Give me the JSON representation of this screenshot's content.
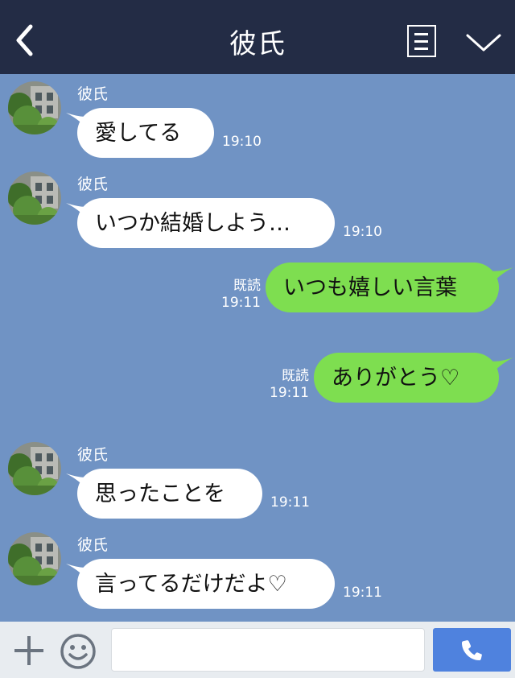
{
  "header": {
    "title": "彼氏",
    "back_icon": "chevron-left-icon",
    "menu_icon": "menu-icon",
    "collapse_icon": "chevron-down-icon"
  },
  "messages": [
    {
      "side": "in",
      "sender": "彼氏",
      "text": "愛してる",
      "time": "19:10"
    },
    {
      "side": "in",
      "sender": "彼氏",
      "text": "いつか結婚しよう…",
      "time": "19:10"
    },
    {
      "side": "out",
      "read": "既読",
      "text": "いつも嬉しい言葉",
      "time": "19:11"
    },
    {
      "side": "out",
      "read": "既読",
      "text": "ありがとう♡",
      "time": "19:11"
    },
    {
      "side": "in",
      "sender": "彼氏",
      "text": "思ったことを",
      "time": "19:11"
    },
    {
      "side": "in",
      "sender": "彼氏",
      "text": "言ってるだけだよ♡",
      "time": "19:11"
    }
  ],
  "input": {
    "value": "",
    "plus_icon": "plus-icon",
    "emoji_icon": "smiley-icon",
    "call_icon": "phone-icon"
  },
  "colors": {
    "header": "#232c45",
    "chat_bg": "#7093c4",
    "bubble_in": "#ffffff",
    "bubble_out": "#7ede50",
    "call_button": "#4f82de"
  }
}
